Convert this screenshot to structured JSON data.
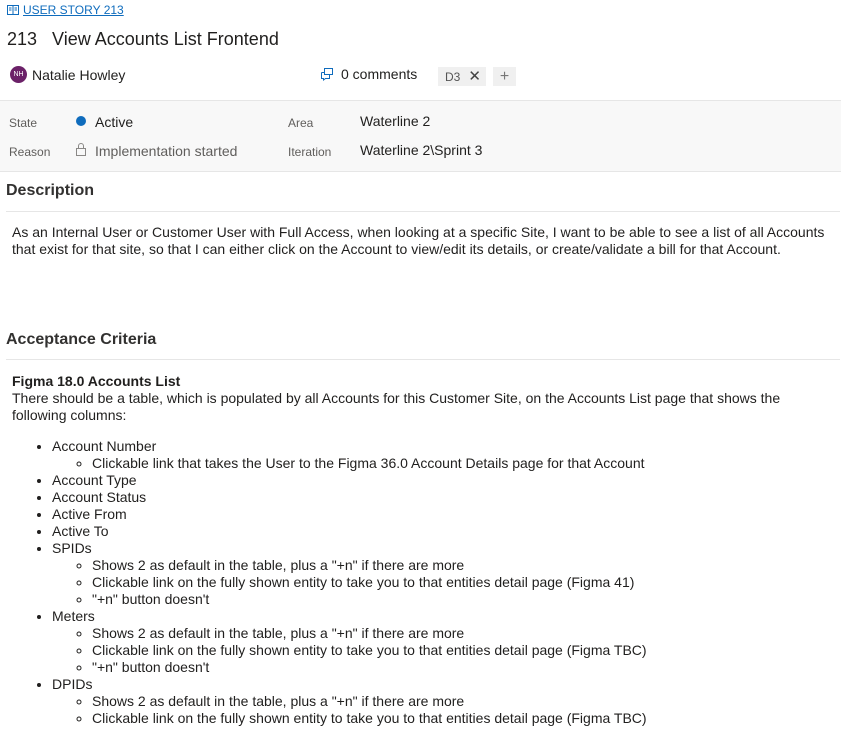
{
  "header": {
    "work_item_type": "USER STORY 213",
    "id": "213",
    "title": "View Accounts List Frontend"
  },
  "meta": {
    "assignee_initials": "NH",
    "assignee_name": "Natalie Howley",
    "comments_label": "0 comments",
    "tag": "D3",
    "tag_remove_glyph": "✕",
    "add_tag_glyph": "+"
  },
  "fields": {
    "state_label": "State",
    "state_value": "Active",
    "state_color": "#0f6cbd",
    "reason_label": "Reason",
    "reason_value": "Implementation started",
    "area_label": "Area",
    "area_value": "Waterline 2",
    "iteration_label": "Iteration",
    "iteration_value": "Waterline 2\\Sprint 3"
  },
  "description": {
    "heading": "Description",
    "text": "As an Internal User or Customer User with Full Access, when looking at a specific Site, I want to be able to see a list of all Accounts that exist for that site, so that I can either click on the Account to view/edit its details, or create/validate a bill for that Account."
  },
  "acceptance": {
    "heading": "Acceptance Criteria",
    "subheading": "Figma 18.0 Accounts List",
    "intro": "There should be a table, which is populated by all Accounts for this Customer Site, on the Accounts List page that shows the following columns:",
    "items": [
      {
        "label": "Account Number",
        "sub": [
          "Clickable link that takes the User to the Figma 36.0 Account Details page for that Account"
        ]
      },
      {
        "label": "Account Type",
        "sub": []
      },
      {
        "label": "Account Status",
        "sub": []
      },
      {
        "label": "Active From",
        "sub": []
      },
      {
        "label": "Active To",
        "sub": []
      },
      {
        "label": "SPIDs",
        "sub": [
          "Shows 2 as default in the table, plus a \"+n\" if there are more",
          "Clickable link on the fully shown entity to take you to that entities detail page (Figma 41)",
          "\"+n\" button doesn't"
        ]
      },
      {
        "label": "Meters",
        "sub": [
          "Shows 2 as default in the table, plus a \"+n\" if there are more",
          "Clickable link on the fully shown entity to take you to that entities detail page (Figma TBC)",
          "\"+n\" button doesn't"
        ]
      },
      {
        "label": "DPIDs",
        "sub": [
          "Shows 2 as default in the table, plus a \"+n\" if there are more",
          "Clickable link on the fully shown entity to take you to that entities detail page (Figma TBC)"
        ]
      }
    ]
  }
}
